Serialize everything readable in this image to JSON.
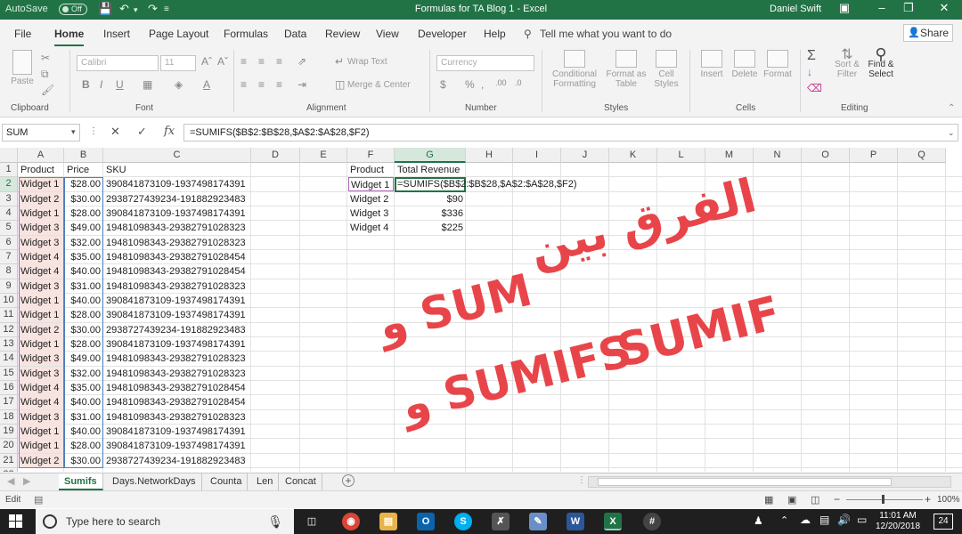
{
  "titlebar": {
    "autosave": "AutoSave",
    "autosave_state": "Off",
    "title": "Formulas for TA Blog 1  -  Excel",
    "user": "Daniel Swift"
  },
  "tabs": [
    "File",
    "Home",
    "Insert",
    "Page Layout",
    "Formulas",
    "Data",
    "Review",
    "View",
    "Developer",
    "Help"
  ],
  "tell_me": "Tell me what you want to do",
  "share": "Share",
  "ribbon": {
    "paste": "Paste",
    "font_name": "Calibri",
    "font_size": "11",
    "wrap_text": "Wrap Text",
    "merge_center": "Merge & Center",
    "number_format": "Currency",
    "conditional_formatting": "Conditional Formatting",
    "format_as_table": "Format as Table",
    "cell_styles": "Cell Styles",
    "insert": "Insert",
    "delete": "Delete",
    "format": "Format",
    "sort_filter": "Sort & Filter",
    "find_select": "Find & Select",
    "groups": {
      "clipboard": "Clipboard",
      "font": "Font",
      "alignment": "Alignment",
      "number": "Number",
      "styles": "Styles",
      "cells": "Cells",
      "editing": "Editing"
    }
  },
  "formula_bar": {
    "name_box": "SUM",
    "formula": "=SUMIFS($B$2:$B$28,$A$2:$A$28,$F2)"
  },
  "columns": [
    "A",
    "B",
    "C",
    "D",
    "E",
    "F",
    "G",
    "H",
    "I",
    "J",
    "K",
    "L",
    "M",
    "N",
    "O",
    "P",
    "Q"
  ],
  "headers": {
    "a": "Product",
    "b": "Price",
    "c": "SKU",
    "f": "Product",
    "g": "Total Revenue"
  },
  "rows": [
    {
      "n": "2",
      "a": "Widget 1",
      "b": "$28.00",
      "c": "390841873109-1937498174391"
    },
    {
      "n": "3",
      "a": "Widget 2",
      "b": "$30.00",
      "c": "2938727439234-191882923483"
    },
    {
      "n": "4",
      "a": "Widget 1",
      "b": "$28.00",
      "c": "390841873109-1937498174391"
    },
    {
      "n": "5",
      "a": "Widget 3",
      "b": "$49.00",
      "c": "19481098343-29382791028323"
    },
    {
      "n": "6",
      "a": "Widget 3",
      "b": "$32.00",
      "c": "19481098343-29382791028323"
    },
    {
      "n": "7",
      "a": "Widget 4",
      "b": "$35.00",
      "c": "19481098343-29382791028454"
    },
    {
      "n": "8",
      "a": "Widget 4",
      "b": "$40.00",
      "c": "19481098343-29382791028454"
    },
    {
      "n": "9",
      "a": "Widget 3",
      "b": "$31.00",
      "c": "19481098343-29382791028323"
    },
    {
      "n": "10",
      "a": "Widget 1",
      "b": "$40.00",
      "c": "390841873109-1937498174391"
    },
    {
      "n": "11",
      "a": "Widget 1",
      "b": "$28.00",
      "c": "390841873109-1937498174391"
    },
    {
      "n": "12",
      "a": "Widget 2",
      "b": "$30.00",
      "c": "2938727439234-191882923483"
    },
    {
      "n": "13",
      "a": "Widget 1",
      "b": "$28.00",
      "c": "390841873109-1937498174391"
    },
    {
      "n": "14",
      "a": "Widget 3",
      "b": "$49.00",
      "c": "19481098343-29382791028323"
    },
    {
      "n": "15",
      "a": "Widget 3",
      "b": "$32.00",
      "c": "19481098343-29382791028323"
    },
    {
      "n": "16",
      "a": "Widget 4",
      "b": "$35.00",
      "c": "19481098343-29382791028454"
    },
    {
      "n": "17",
      "a": "Widget 4",
      "b": "$40.00",
      "c": "19481098343-29382791028454"
    },
    {
      "n": "18",
      "a": "Widget 3",
      "b": "$31.00",
      "c": "19481098343-29382791028323"
    },
    {
      "n": "19",
      "a": "Widget 1",
      "b": "$40.00",
      "c": "390841873109-1937498174391"
    },
    {
      "n": "20",
      "a": "Widget 1",
      "b": "$28.00",
      "c": "390841873109-1937498174391"
    },
    {
      "n": "21",
      "a": "Widget 2",
      "b": "$30.00",
      "c": "2938727439234-191882923483"
    }
  ],
  "summary": [
    {
      "f": "Widget 1",
      "g": "=SUMIFS($B$2:$B$28,$A$2:$A$28,$F2)"
    },
    {
      "f": "Widget 2",
      "g": "$90"
    },
    {
      "f": "Widget 3",
      "g": "$336"
    },
    {
      "f": "Widget 4",
      "g": "$225"
    }
  ],
  "overlay": {
    "line1": "الفرق بين",
    "line2": "SUM و",
    "line3": "SUMIF",
    "line4": "SUMIFS و"
  },
  "sheet_tabs": [
    "Sumifs",
    "Days.NetworkDays",
    "Counta",
    "Len",
    "Concat"
  ],
  "status": {
    "mode": "Edit",
    "zoom": "100%"
  },
  "taskbar": {
    "search_placeholder": "Type here to search",
    "time": "11:01 AM",
    "date": "12/20/2018",
    "notifications": "24"
  },
  "colors": {
    "excel_green": "#217346",
    "overlay_red": "#e8454a"
  }
}
